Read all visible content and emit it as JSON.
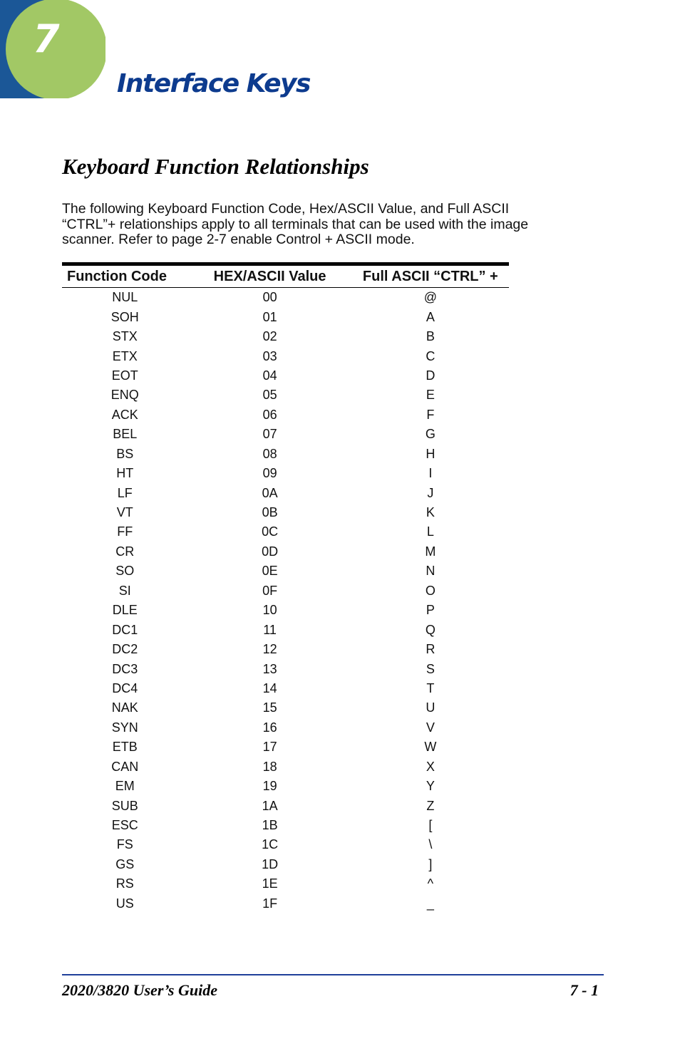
{
  "chapter": {
    "number": "7",
    "title": "Interface Keys"
  },
  "section": {
    "heading": "Keyboard Function Relationships",
    "intro_lines": [
      "The following Keyboard Function Code, Hex/ASCII Value, and Full ASCII",
      "“CTRL”+  relationships apply to all terminals that can be used with the image",
      "scanner.  Refer to page 2-7 enable Control + ASCII mode."
    ]
  },
  "table": {
    "headers": [
      "Function Code",
      "HEX/ASCII Value",
      "Full ASCII “CTRL” +"
    ],
    "rows": [
      [
        "NUL",
        "00",
        "@"
      ],
      [
        "SOH",
        "01",
        "A"
      ],
      [
        "STX",
        "02",
        "B"
      ],
      [
        "ETX",
        "03",
        "C"
      ],
      [
        "EOT",
        "04",
        "D"
      ],
      [
        "ENQ",
        "05",
        "E"
      ],
      [
        "ACK",
        "06",
        "F"
      ],
      [
        "BEL",
        "07",
        "G"
      ],
      [
        "BS",
        "08",
        "H"
      ],
      [
        "HT",
        "09",
        "I"
      ],
      [
        "LF",
        "0A",
        "J"
      ],
      [
        "VT",
        "0B",
        "K"
      ],
      [
        "FF",
        "0C",
        "L"
      ],
      [
        "CR",
        "0D",
        "M"
      ],
      [
        "SO",
        "0E",
        "N"
      ],
      [
        "SI",
        "0F",
        "O"
      ],
      [
        "DLE",
        "10",
        "P"
      ],
      [
        "DC1",
        "11",
        "Q"
      ],
      [
        "DC2",
        "12",
        "R"
      ],
      [
        "DC3",
        "13",
        "S"
      ],
      [
        "DC4",
        "14",
        "T"
      ],
      [
        "NAK",
        "15",
        "U"
      ],
      [
        "SYN",
        "16",
        "V"
      ],
      [
        "ETB",
        "17",
        "W"
      ],
      [
        "CAN",
        "18",
        "X"
      ],
      [
        "EM",
        "19",
        "Y"
      ],
      [
        "SUB",
        "1A",
        "Z"
      ],
      [
        "ESC",
        "1B",
        "["
      ],
      [
        "FS",
        "1C",
        "\\"
      ],
      [
        "GS",
        "1D",
        "]"
      ],
      [
        "RS",
        "1E",
        "^"
      ],
      [
        "US",
        "1F",
        "_"
      ]
    ]
  },
  "footer": {
    "guide_title": "2020/3820 User’s Guide",
    "page_number": "7 - 1"
  },
  "colors": {
    "chapter_blue": "#1b5797",
    "chapter_green": "#a2c865",
    "title_blue": "#0d3b8e",
    "footer_rule": "#1f3f9a"
  }
}
